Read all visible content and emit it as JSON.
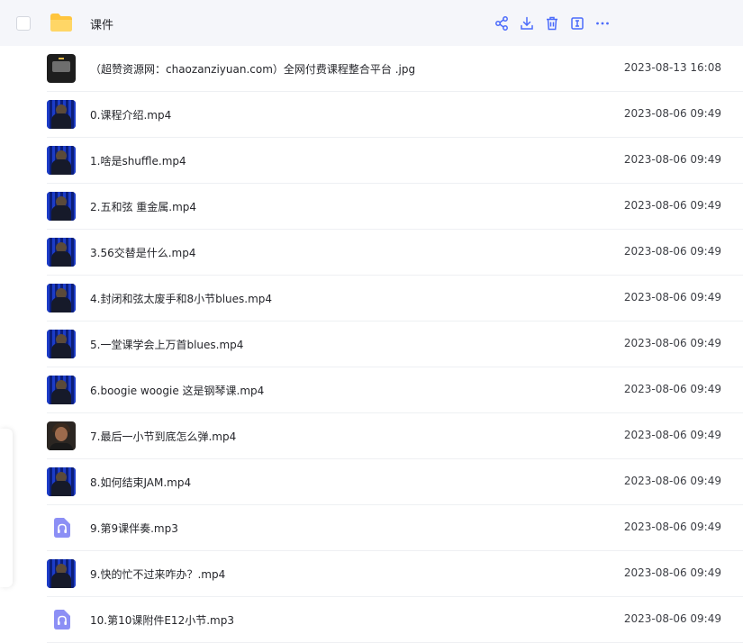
{
  "folder": {
    "name": "课件",
    "actions": [
      "share-icon",
      "download-icon",
      "delete-icon",
      "rename-icon",
      "more-icon"
    ],
    "accent_color": "#4b6bfb",
    "icon_color": "#ffc53d"
  },
  "files": [
    {
      "name": "（超赞资源网：chaozanziyuan.com）全网付费课程整合平台 .jpg",
      "date": "2023-08-13 16:08",
      "thumb": "device"
    },
    {
      "name": "0.课程介绍.mp4",
      "date": "2023-08-06 09:49",
      "thumb": "video"
    },
    {
      "name": "1.啥是shuffle.mp4",
      "date": "2023-08-06 09:49",
      "thumb": "video"
    },
    {
      "name": "2.五和弦 重金属.mp4",
      "date": "2023-08-06 09:49",
      "thumb": "video"
    },
    {
      "name": "3.56交替是什么.mp4",
      "date": "2023-08-06 09:49",
      "thumb": "video"
    },
    {
      "name": "4.封闭和弦太废手和8小节blues.mp4",
      "date": "2023-08-06 09:49",
      "thumb": "video"
    },
    {
      "name": "5.一堂课学会上万首blues.mp4",
      "date": "2023-08-06 09:49",
      "thumb": "video"
    },
    {
      "name": "6.boogie woogie 这是钢琴课.mp4",
      "date": "2023-08-06 09:49",
      "thumb": "video"
    },
    {
      "name": "7.最后一小节到底怎么弹.mp4",
      "date": "2023-08-06 09:49",
      "thumb": "portrait"
    },
    {
      "name": "8.如何结束JAM.mp4",
      "date": "2023-08-06 09:49",
      "thumb": "video"
    },
    {
      "name": "9.第9课伴奏.mp3",
      "date": "2023-08-06 09:49",
      "thumb": "audio"
    },
    {
      "name": "9.快的忙不过来咋办？.mp4",
      "date": "2023-08-06 09:49",
      "thumb": "video"
    },
    {
      "name": "10.第10课附件E12小节.mp3",
      "date": "2023-08-06 09:49",
      "thumb": "audio"
    }
  ]
}
